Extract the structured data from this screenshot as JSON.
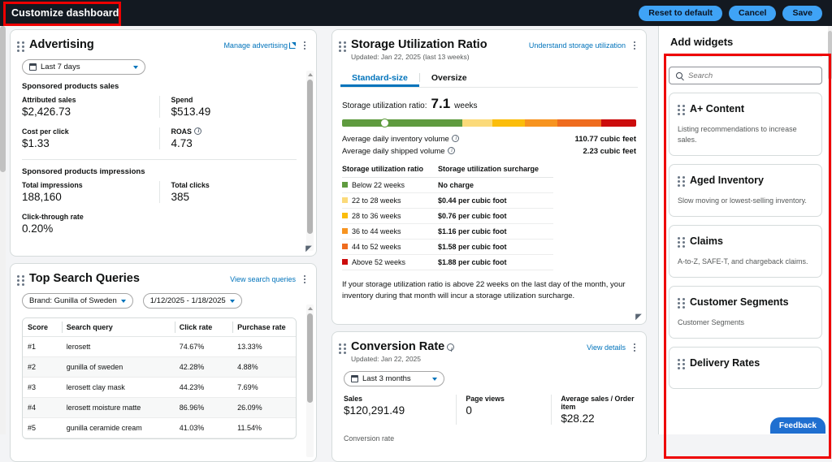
{
  "topbar": {
    "title": "Customize dashboard",
    "reset_label": "Reset to default",
    "cancel_label": "Cancel",
    "save_label": "Save",
    "accent": "#3fa3f6",
    "background": "#131921"
  },
  "advertising": {
    "title": "Advertising",
    "manage_link": "Manage advertising",
    "date_filter": "Last 7 days",
    "section_sales": "Sponsored products sales",
    "metrics_sales": [
      {
        "label": "Attributed sales",
        "value": "$2,426.73"
      },
      {
        "label": "Spend",
        "value": "$513.49"
      },
      {
        "label": "Cost per click",
        "value": "$1.33"
      },
      {
        "label": "ROAS",
        "value": "4.73",
        "info": true
      }
    ],
    "section_impressions": "Sponsored products impressions",
    "metrics_impressions": [
      {
        "label": "Total impressions",
        "value": "188,160"
      },
      {
        "label": "Total clicks",
        "value": "385"
      }
    ],
    "ctr_label": "Click-through rate",
    "ctr_value": "0.20%"
  },
  "top_search_queries": {
    "title": "Top Search Queries",
    "view_link": "View search queries",
    "brand_filter": "Brand: Gunilla of Sweden",
    "date_filter": "1/12/2025 - 1/18/2025",
    "columns": [
      "Score",
      "Search query",
      "Click rate",
      "Purchase rate"
    ],
    "rows": [
      [
        "#1",
        "lerosett",
        "74.67%",
        "13.33%"
      ],
      [
        "#2",
        "gunilla of sweden",
        "42.28%",
        "4.88%"
      ],
      [
        "#3",
        "lerosett clay mask",
        "44.23%",
        "7.69%"
      ],
      [
        "#4",
        "lerosett moisture matte",
        "86.96%",
        "26.09%"
      ],
      [
        "#5",
        "gunilla ceramide cream",
        "41.03%",
        "11.54%"
      ]
    ]
  },
  "storage": {
    "title": "Storage Utilization Ratio",
    "updated": "Updated: Jan 22, 2025 (last 13 weeks)",
    "understand_link": "Understand storage utilization",
    "tabs": [
      {
        "label": "Standard-size",
        "active": true
      },
      {
        "label": "Oversize",
        "active": false
      }
    ],
    "ratio_label": "Storage utilization ratio:",
    "ratio_value": "7.1",
    "ratio_unit": "weeks",
    "gauge": {
      "marker_percent": 14,
      "segments": [
        {
          "color": "#5f9b3f",
          "width": 52
        },
        {
          "color": "#fbda7a",
          "width": 13
        },
        {
          "color": "#fbbd0b",
          "width": 14
        },
        {
          "color": "#f79420",
          "width": 14
        },
        {
          "color": "#ef6c1e",
          "width": 19
        },
        {
          "color": "#cc0c0c",
          "width": 15
        }
      ]
    },
    "volumes": [
      {
        "label": "Average daily inventory volume",
        "value": "110.77 cubic feet"
      },
      {
        "label": "Average daily shipped volume",
        "value": "2.23 cubic feet"
      }
    ],
    "table_columns": [
      "Storage utilization ratio",
      "Storage utilization surcharge"
    ],
    "table_rows": [
      {
        "color": "#5f9b3f",
        "range": "Below 22 weeks",
        "charge": "No charge"
      },
      {
        "color": "#fbda7a",
        "range": "22 to 28 weeks",
        "charge": "$0.44 per cubic foot"
      },
      {
        "color": "#fbbd0b",
        "range": "28 to 36 weeks",
        "charge": "$0.76 per cubic foot"
      },
      {
        "color": "#f79420",
        "range": "36 to 44 weeks",
        "charge": "$1.16 per cubic foot"
      },
      {
        "color": "#ef6c1e",
        "range": "44 to 52 weeks",
        "charge": "$1.58 per cubic foot"
      },
      {
        "color": "#cc0c0c",
        "range": "Above 52 weeks",
        "charge": "$1.88 per cubic foot"
      }
    ],
    "footnote": "If your storage utilization ratio is above 22 weeks on the last day of the month, your inventory during that month will incur a storage utilization surcharge."
  },
  "conversion": {
    "title": "Conversion Rate",
    "updated": "Updated: Jan 22, 2025",
    "view_link": "View details",
    "date_filter": "Last 3 months",
    "metrics": [
      {
        "label": "Sales",
        "value": "$120,291.49"
      },
      {
        "label": "Page views",
        "value": "0"
      },
      {
        "label": "Average sales / Order item",
        "value": "$28.22"
      }
    ],
    "rate_label": "Conversion rate"
  },
  "add_widgets": {
    "title": "Add widgets",
    "search_placeholder": "Search",
    "search_value": "",
    "widgets": [
      {
        "name": "A+ Content",
        "desc": "Listing recommendations to increase sales."
      },
      {
        "name": "Aged Inventory",
        "desc": "Slow moving or lowest-selling inventory."
      },
      {
        "name": "Claims",
        "desc": "A-to-Z, SAFE-T, and chargeback claims."
      },
      {
        "name": "Customer Segments",
        "desc": "Customer Segments"
      },
      {
        "name": "Delivery Rates",
        "desc": ""
      }
    ]
  },
  "feedback": {
    "label": "Feedback"
  }
}
